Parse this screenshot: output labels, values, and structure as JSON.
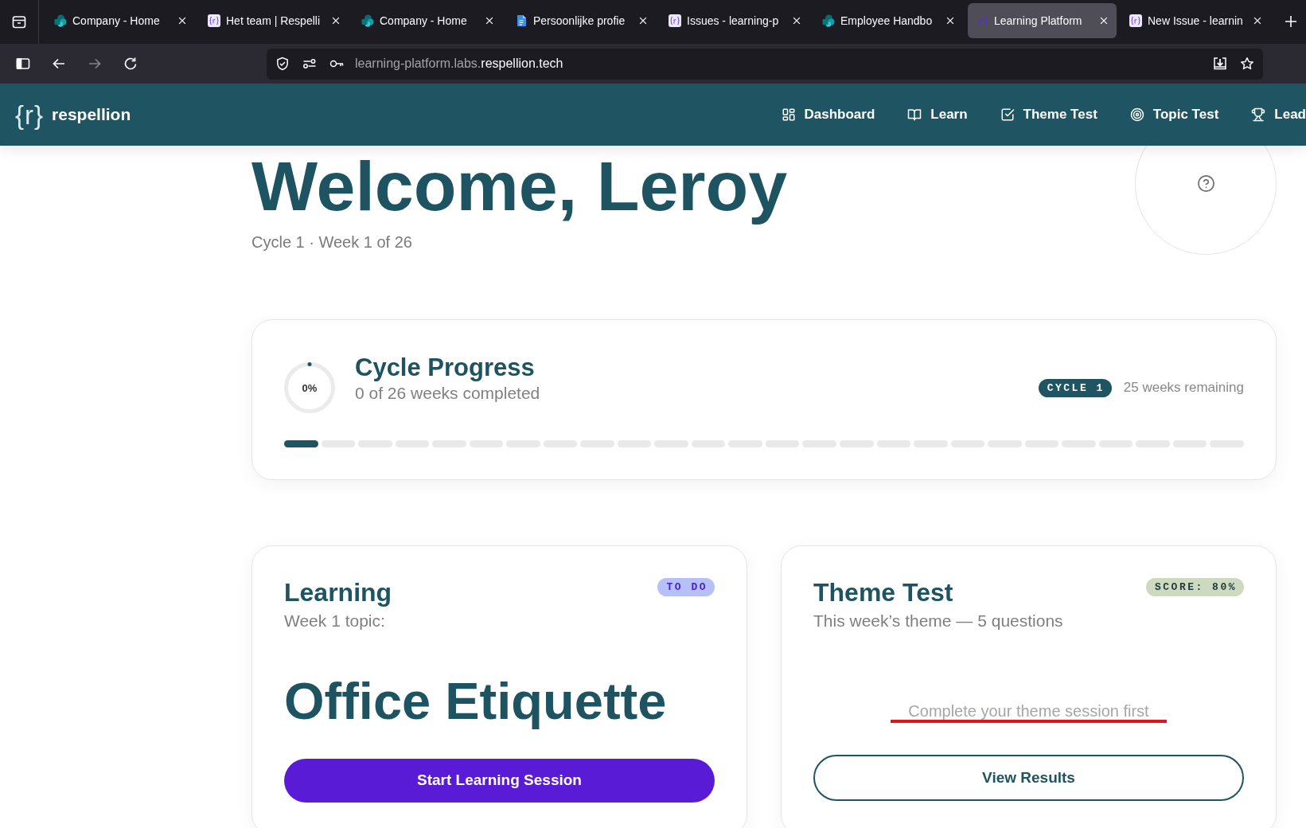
{
  "browser": {
    "tabs": [
      {
        "title": "Company - Home",
        "kind": "cluster",
        "selected": false
      },
      {
        "title": "Het team | Respelli",
        "kind": "brace",
        "selected": false
      },
      {
        "title": "Company - Home",
        "kind": "cluster",
        "selected": false
      },
      {
        "title": "Persoonlijke profie",
        "kind": "document",
        "selected": false
      },
      {
        "title": "Issues - learning-p",
        "kind": "brace",
        "selected": false
      },
      {
        "title": "Employee Handbo",
        "kind": "cluster",
        "selected": false
      },
      {
        "title": "Learning Platform",
        "kind": "outline",
        "selected": true
      },
      {
        "title": "New Issue - learnin",
        "kind": "brace",
        "selected": false
      }
    ],
    "nav_buttons": [
      {
        "kind": "back",
        "disabled": false
      },
      {
        "kind": "forward",
        "disabled": true
      },
      {
        "kind": "reload",
        "disabled": false
      }
    ],
    "url": {
      "prefix": "learning-platform.labs.",
      "domain": "respellion.tech"
    }
  },
  "app_nav": {
    "logo_mark": "{r}",
    "brand": "respellion",
    "links": [
      "Dashboard",
      "Learn",
      "Theme Test",
      "Topic Test",
      "Lead"
    ]
  },
  "welcome": {
    "heading": "Welcome, Leroy",
    "subtitle": "Cycle 1 · Week 1 of 26"
  },
  "cycle_progress": {
    "title": "Cycle Progress",
    "subtitle": "0 of 26 weeks completed",
    "ring": {
      "level": 0,
      "label": "0%"
    },
    "badge": "CYCLE 1",
    "remaining": "25 weeks remaining",
    "weeks": [
      {
        "filled": true
      },
      {
        "filled": false
      },
      {
        "filled": false
      },
      {
        "filled": false
      },
      {
        "filled": false
      },
      {
        "filled": false
      },
      {
        "filled": false
      },
      {
        "filled": false
      },
      {
        "filled": false
      },
      {
        "filled": false
      },
      {
        "filled": false
      },
      {
        "filled": false
      },
      {
        "filled": false
      },
      {
        "filled": false
      },
      {
        "filled": false
      },
      {
        "filled": false
      },
      {
        "filled": false
      },
      {
        "filled": false
      },
      {
        "filled": false
      },
      {
        "filled": false
      },
      {
        "filled": false
      },
      {
        "filled": false
      },
      {
        "filled": false
      },
      {
        "filled": false
      },
      {
        "filled": false
      },
      {
        "filled": false
      }
    ]
  },
  "learning": {
    "title": "Learning",
    "subtitle": "Week 1 topic:",
    "badge": "TO DO",
    "topic": "Office Etiquette",
    "button": "Start Learning Session"
  },
  "theme_test": {
    "title": "Theme Test",
    "subtitle": "This week’s theme — 5 questions",
    "badge": "SCORE: 80%",
    "note": {
      "text": "Complete your theme session first",
      "underlined": true
    },
    "button": "View Results"
  }
}
